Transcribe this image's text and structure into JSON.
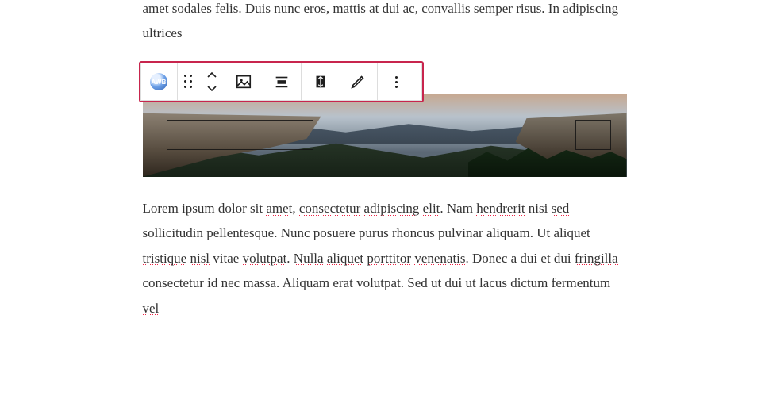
{
  "paragraphs": {
    "first": "venenatis. Donec a dui et dui fringilla consectetur id nec massa. Aliquam erat volutpat. Sed ut dui ut lacus dictum fermentum vel tincidunt neque. Sed sed lacinia lectus. Duis sit amet sodales felis. Duis nunc eros, mattis at dui ac, convallis semper risus. In adipiscing ultrices",
    "second_tokens": [
      {
        "t": "Lorem ipsum dolor sit "
      },
      {
        "t": "amet",
        "s": 1
      },
      {
        "t": ", "
      },
      {
        "t": "consectetur",
        "s": 1
      },
      {
        "t": " "
      },
      {
        "t": "adipiscing",
        "s": 1
      },
      {
        "t": " "
      },
      {
        "t": "elit",
        "s": 1
      },
      {
        "t": ". Nam "
      },
      {
        "t": "hendrerit",
        "s": 1
      },
      {
        "t": " nisi "
      },
      {
        "t": "sed",
        "s": 1
      },
      {
        "t": " "
      },
      {
        "t": "sollicitudin",
        "s": 1
      },
      {
        "t": " "
      },
      {
        "t": "pellentesque",
        "s": 1
      },
      {
        "t": ". Nunc "
      },
      {
        "t": "posuere",
        "s": 1
      },
      {
        "t": " "
      },
      {
        "t": "purus",
        "s": 1
      },
      {
        "t": " "
      },
      {
        "t": "rhoncus",
        "s": 1
      },
      {
        "t": " pulvinar "
      },
      {
        "t": "aliquam",
        "s": 1
      },
      {
        "t": ". "
      },
      {
        "t": "Ut",
        "s": 1
      },
      {
        "t": " "
      },
      {
        "t": "aliquet",
        "s": 1
      },
      {
        "t": " "
      },
      {
        "t": "tristique",
        "s": 1
      },
      {
        "t": " "
      },
      {
        "t": "nisl",
        "s": 1
      },
      {
        "t": " vitae "
      },
      {
        "t": "volutpat",
        "s": 1
      },
      {
        "t": ". "
      },
      {
        "t": "Nulla",
        "s": 1
      },
      {
        "t": " "
      },
      {
        "t": "aliquet",
        "s": 1
      },
      {
        "t": " "
      },
      {
        "t": "porttitor",
        "s": 1
      },
      {
        "t": " "
      },
      {
        "t": "venenatis",
        "s": 1
      },
      {
        "t": ". Donec a dui et dui "
      },
      {
        "t": "fringilla",
        "s": 1
      },
      {
        "t": " "
      },
      {
        "t": "consectetur",
        "s": 1
      },
      {
        "t": " id "
      },
      {
        "t": "nec",
        "s": 1
      },
      {
        "t": " "
      },
      {
        "t": "massa",
        "s": 1
      },
      {
        "t": ". Aliquam "
      },
      {
        "t": "erat",
        "s": 1
      },
      {
        "t": " "
      },
      {
        "t": "volutpat",
        "s": 1
      },
      {
        "t": ". Sed "
      },
      {
        "t": "ut",
        "s": 1
      },
      {
        "t": " dui "
      },
      {
        "t": "ut",
        "s": 1
      },
      {
        "t": " "
      },
      {
        "t": "lacus",
        "s": 1
      },
      {
        "t": " dictum "
      },
      {
        "t": "fermentum",
        "s": 1
      },
      {
        "t": " "
      },
      {
        "t": "vel",
        "s": 1
      }
    ]
  },
  "toolbar": {
    "logo_text": "AWB",
    "buttons": {
      "block_type": "awb-block-button",
      "drag": "drag-handle",
      "move": "move-up-down",
      "image": "image-settings",
      "align": "alignment",
      "fullheight": "full-height",
      "edit": "edit-pencil",
      "more": "more-options"
    }
  },
  "image_block": {
    "alt": "mountain-valley-sunset-panorama"
  }
}
